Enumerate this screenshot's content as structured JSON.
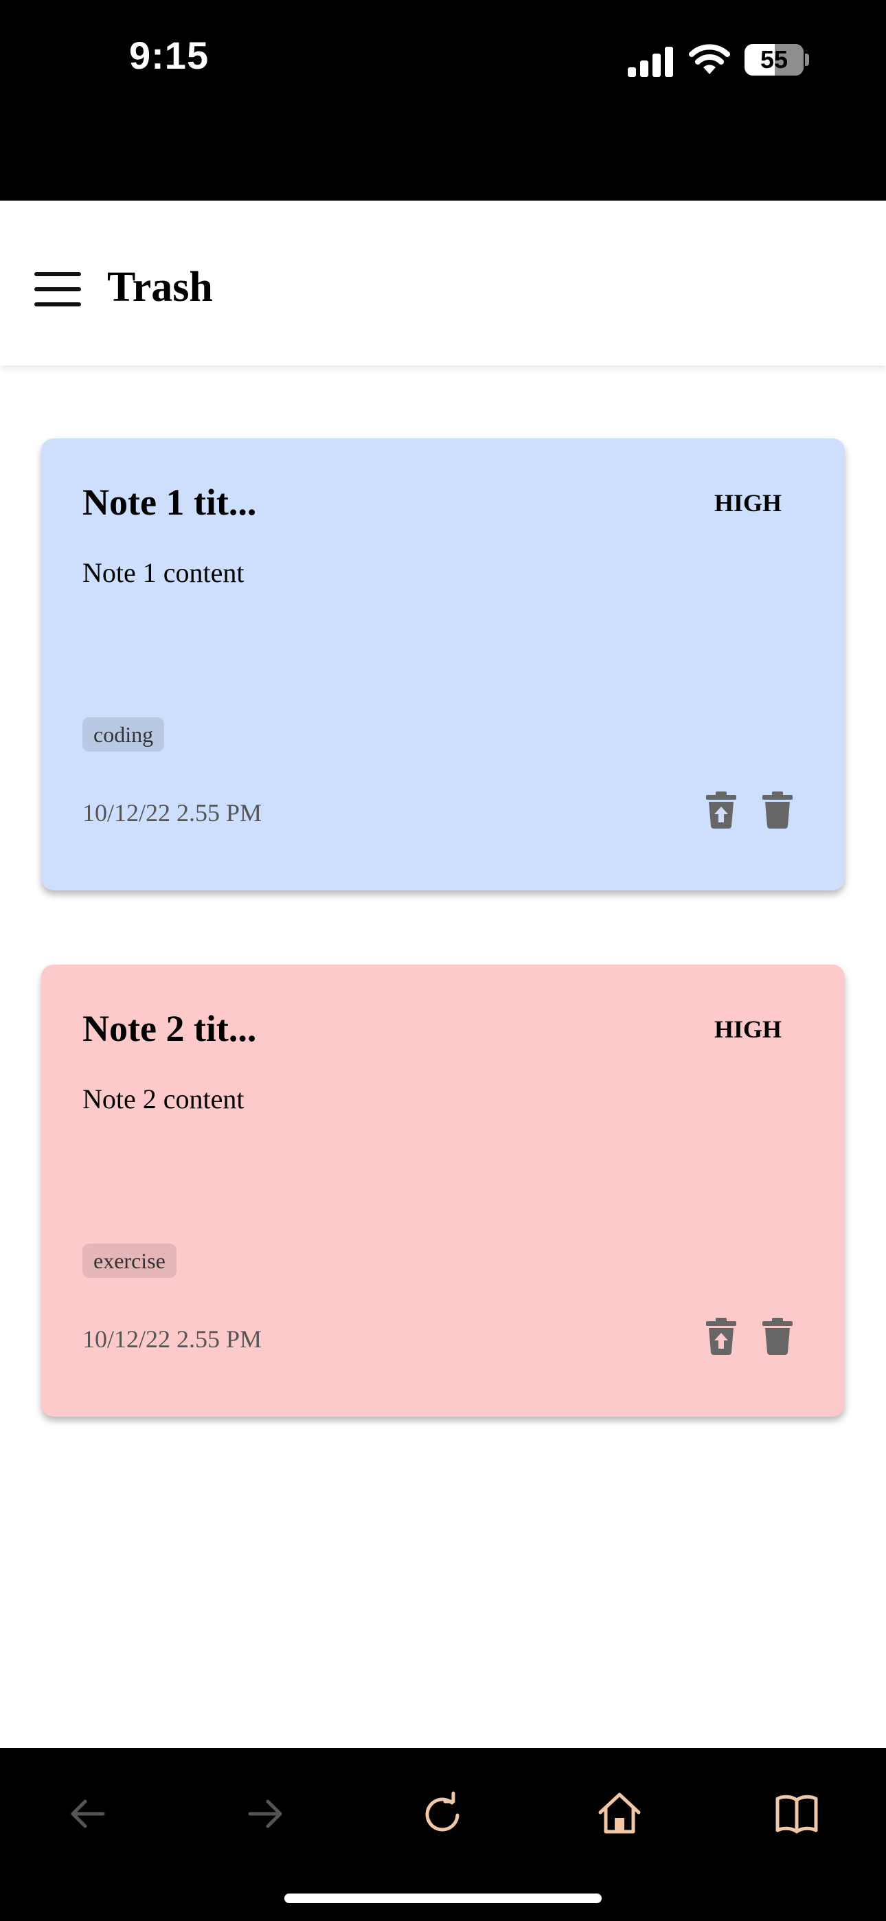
{
  "status_bar": {
    "time": "9:15",
    "battery": "55"
  },
  "header": {
    "title": "Trash"
  },
  "notes": [
    {
      "title": "Note 1 tit...",
      "priority": "HIGH",
      "content": "Note 1 content",
      "tag": "coding",
      "date": "10/12/22 2.55 PM",
      "color": "#cddffd"
    },
    {
      "title": "Note 2 tit...",
      "priority": "HIGH",
      "content": "Note 2 content",
      "tag": "exercise",
      "date": "10/12/22 2.55 PM",
      "color": "#fdcacb"
    }
  ],
  "icons": {
    "menu": "hamburger-menu-icon",
    "restore": "trash-restore-icon",
    "delete": "trash-icon",
    "browser": [
      "back-arrow-icon",
      "forward-arrow-icon",
      "reload-icon",
      "home-icon",
      "bookmarks-icon"
    ]
  },
  "colors": {
    "toolbar_accent": "#f0c8a8",
    "icon_gray": "#666666"
  }
}
